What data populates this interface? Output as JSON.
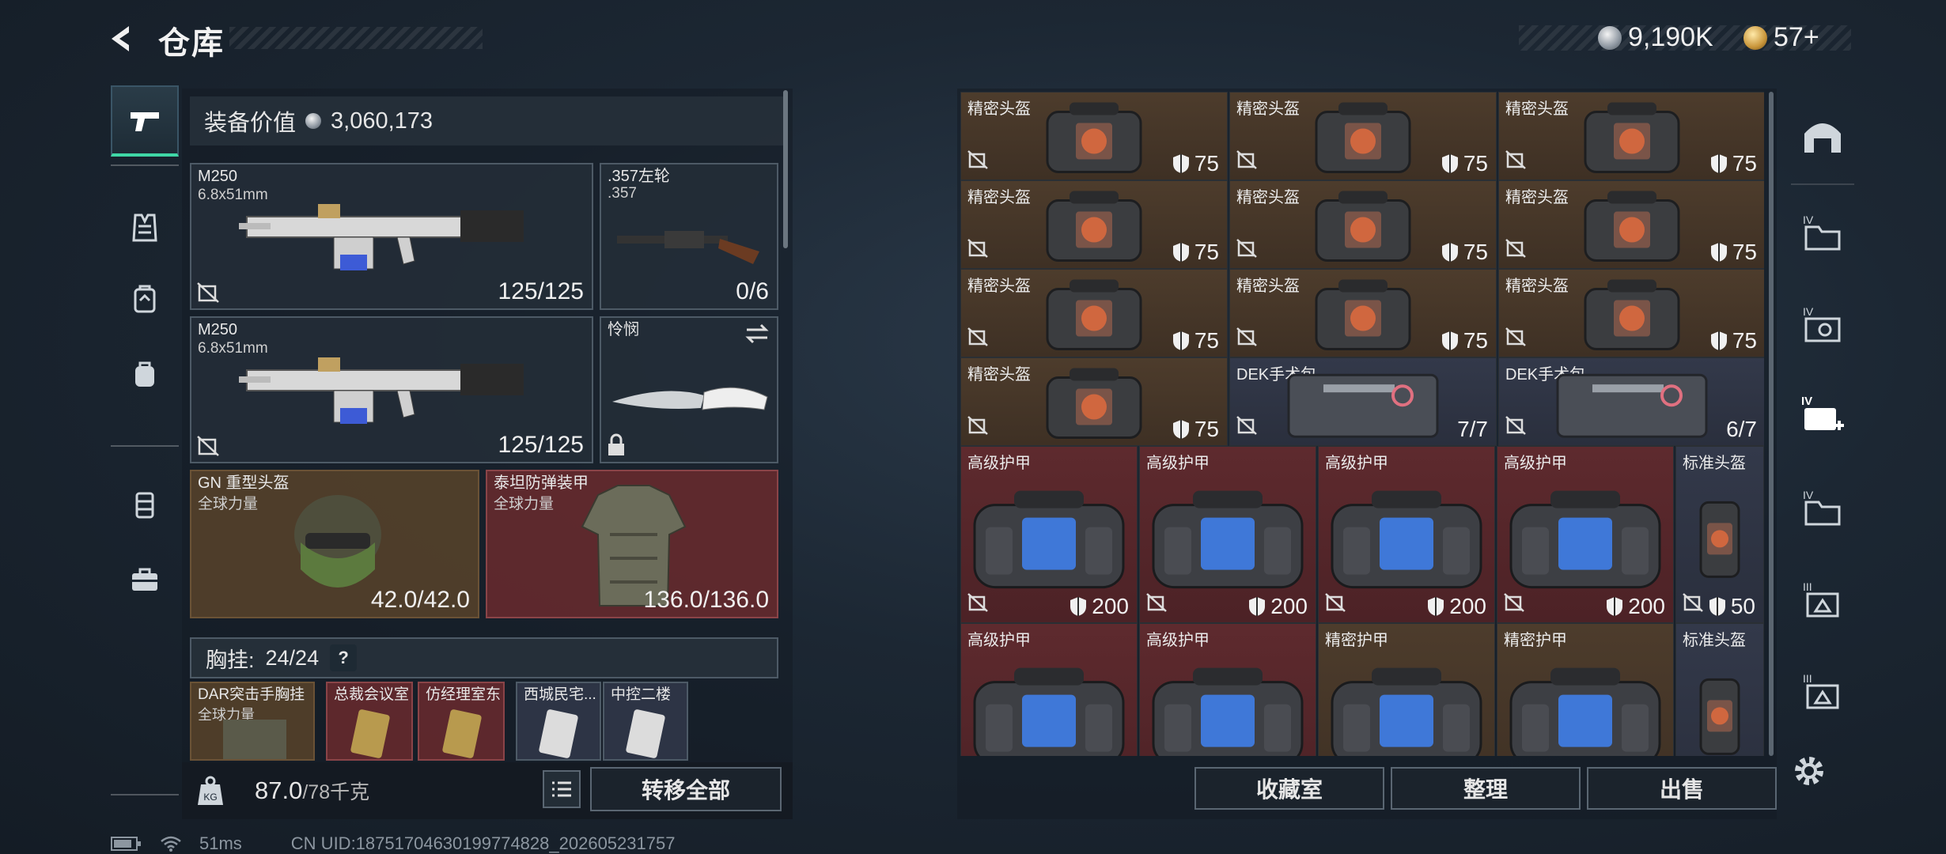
{
  "header": {
    "title": "仓库",
    "currency_silver": "9,190K",
    "currency_gold": "57+"
  },
  "left_nav": {
    "items": [
      "pistol-icon",
      "vest-icon",
      "backpack-tactical-icon",
      "backpack-icon",
      "armor-icon",
      "case-icon"
    ]
  },
  "loadout": {
    "equip_value_label": "装备价值",
    "equip_value": "3,060,173",
    "primary1": {
      "name": "M250",
      "caliber": "6.8x51mm",
      "count": "125/125"
    },
    "sidearm": {
      "name": ".357左轮",
      "caliber": ".357",
      "count": "0/6"
    },
    "primary2": {
      "name": "M250",
      "caliber": "6.8x51mm",
      "count": "125/125"
    },
    "melee": {
      "name": "怜悯"
    },
    "helmet": {
      "name": "GN 重型头盔",
      "faction": "全球力量",
      "durability": "42.0/42.0"
    },
    "armor": {
      "name": "泰坦防弹装甲",
      "faction": "全球力量",
      "durability": "136.0/136.0"
    },
    "chest_label": "胸挂:",
    "chest_capacity": "24/24",
    "chest_help": "?",
    "chest_items": [
      {
        "name": "DAR突击手胸挂",
        "sub": "全球力量"
      },
      {
        "name": "总裁会议室"
      },
      {
        "name": "仿经理室东"
      },
      {
        "name": "西城民宅..."
      },
      {
        "name": "中控二楼"
      }
    ],
    "weight": "87.0",
    "weight_max": "/78千克",
    "transfer_all": "转移全部"
  },
  "storage": {
    "rows": [
      [
        {
          "name": "精密头盔",
          "value": "75",
          "color": "brown",
          "art": "bag"
        },
        {
          "name": "精密头盔",
          "value": "75",
          "color": "brown",
          "art": "bag"
        },
        {
          "name": "精密头盔",
          "value": "75",
          "color": "brown",
          "art": "bag"
        }
      ],
      [
        {
          "name": "精密头盔",
          "value": "75",
          "color": "brown",
          "art": "bag"
        },
        {
          "name": "精密头盔",
          "value": "75",
          "color": "brown",
          "art": "bag"
        },
        {
          "name": "精密头盔",
          "value": "75",
          "color": "brown",
          "art": "bag"
        }
      ],
      [
        {
          "name": "精密头盔",
          "value": "75",
          "color": "brown",
          "art": "bag"
        },
        {
          "name": "精密头盔",
          "value": "75",
          "color": "brown",
          "art": "bag"
        },
        {
          "name": "精密头盔",
          "value": "75",
          "color": "brown",
          "art": "bag"
        }
      ],
      [
        {
          "name": "精密头盔",
          "value": "75",
          "color": "brown",
          "art": "bag"
        },
        {
          "name": "DEK手术包",
          "value": "7/7",
          "color": "blue",
          "art": "medkit"
        },
        {
          "name": "DEK手术包",
          "value": "6/7",
          "color": "blue",
          "art": "medkit"
        }
      ]
    ],
    "big_rows": [
      [
        {
          "name": "高级护甲",
          "value": "200",
          "color": "red"
        },
        {
          "name": "高级护甲",
          "value": "200",
          "color": "red"
        },
        {
          "name": "高级护甲",
          "value": "200",
          "color": "red"
        },
        {
          "name": "高级护甲",
          "value": "200",
          "color": "red"
        }
      ],
      [
        {
          "name": "高级护甲",
          "value": "",
          "color": "red"
        },
        {
          "name": "高级护甲",
          "value": "",
          "color": "red"
        },
        {
          "name": "精密护甲",
          "value": "",
          "color": "brown"
        },
        {
          "name": "精密护甲",
          "value": "",
          "color": "brown"
        }
      ]
    ],
    "side_cells": [
      {
        "name": "标准头盔",
        "value": "50"
      },
      {
        "name": "标准头盔",
        "value": ""
      }
    ],
    "actions": [
      "收藏室",
      "整理",
      "出售"
    ]
  },
  "right_nav": {
    "items": [
      "home-storage-icon",
      "folder-iv-icon",
      "search-iv-icon",
      "medical-iv-icon",
      "folder-iv-2-icon",
      "armor-iii-icon",
      "armor-iii-2-icon"
    ]
  },
  "status": {
    "ping": "51ms",
    "uid": "CN UID:18751704630199774828_202605231757"
  },
  "colors": {
    "accent_green": "#3fd7a6",
    "cell_brown": "#4d3c2c",
    "cell_red": "#5e2a2e",
    "cell_blue": "#33394a"
  }
}
